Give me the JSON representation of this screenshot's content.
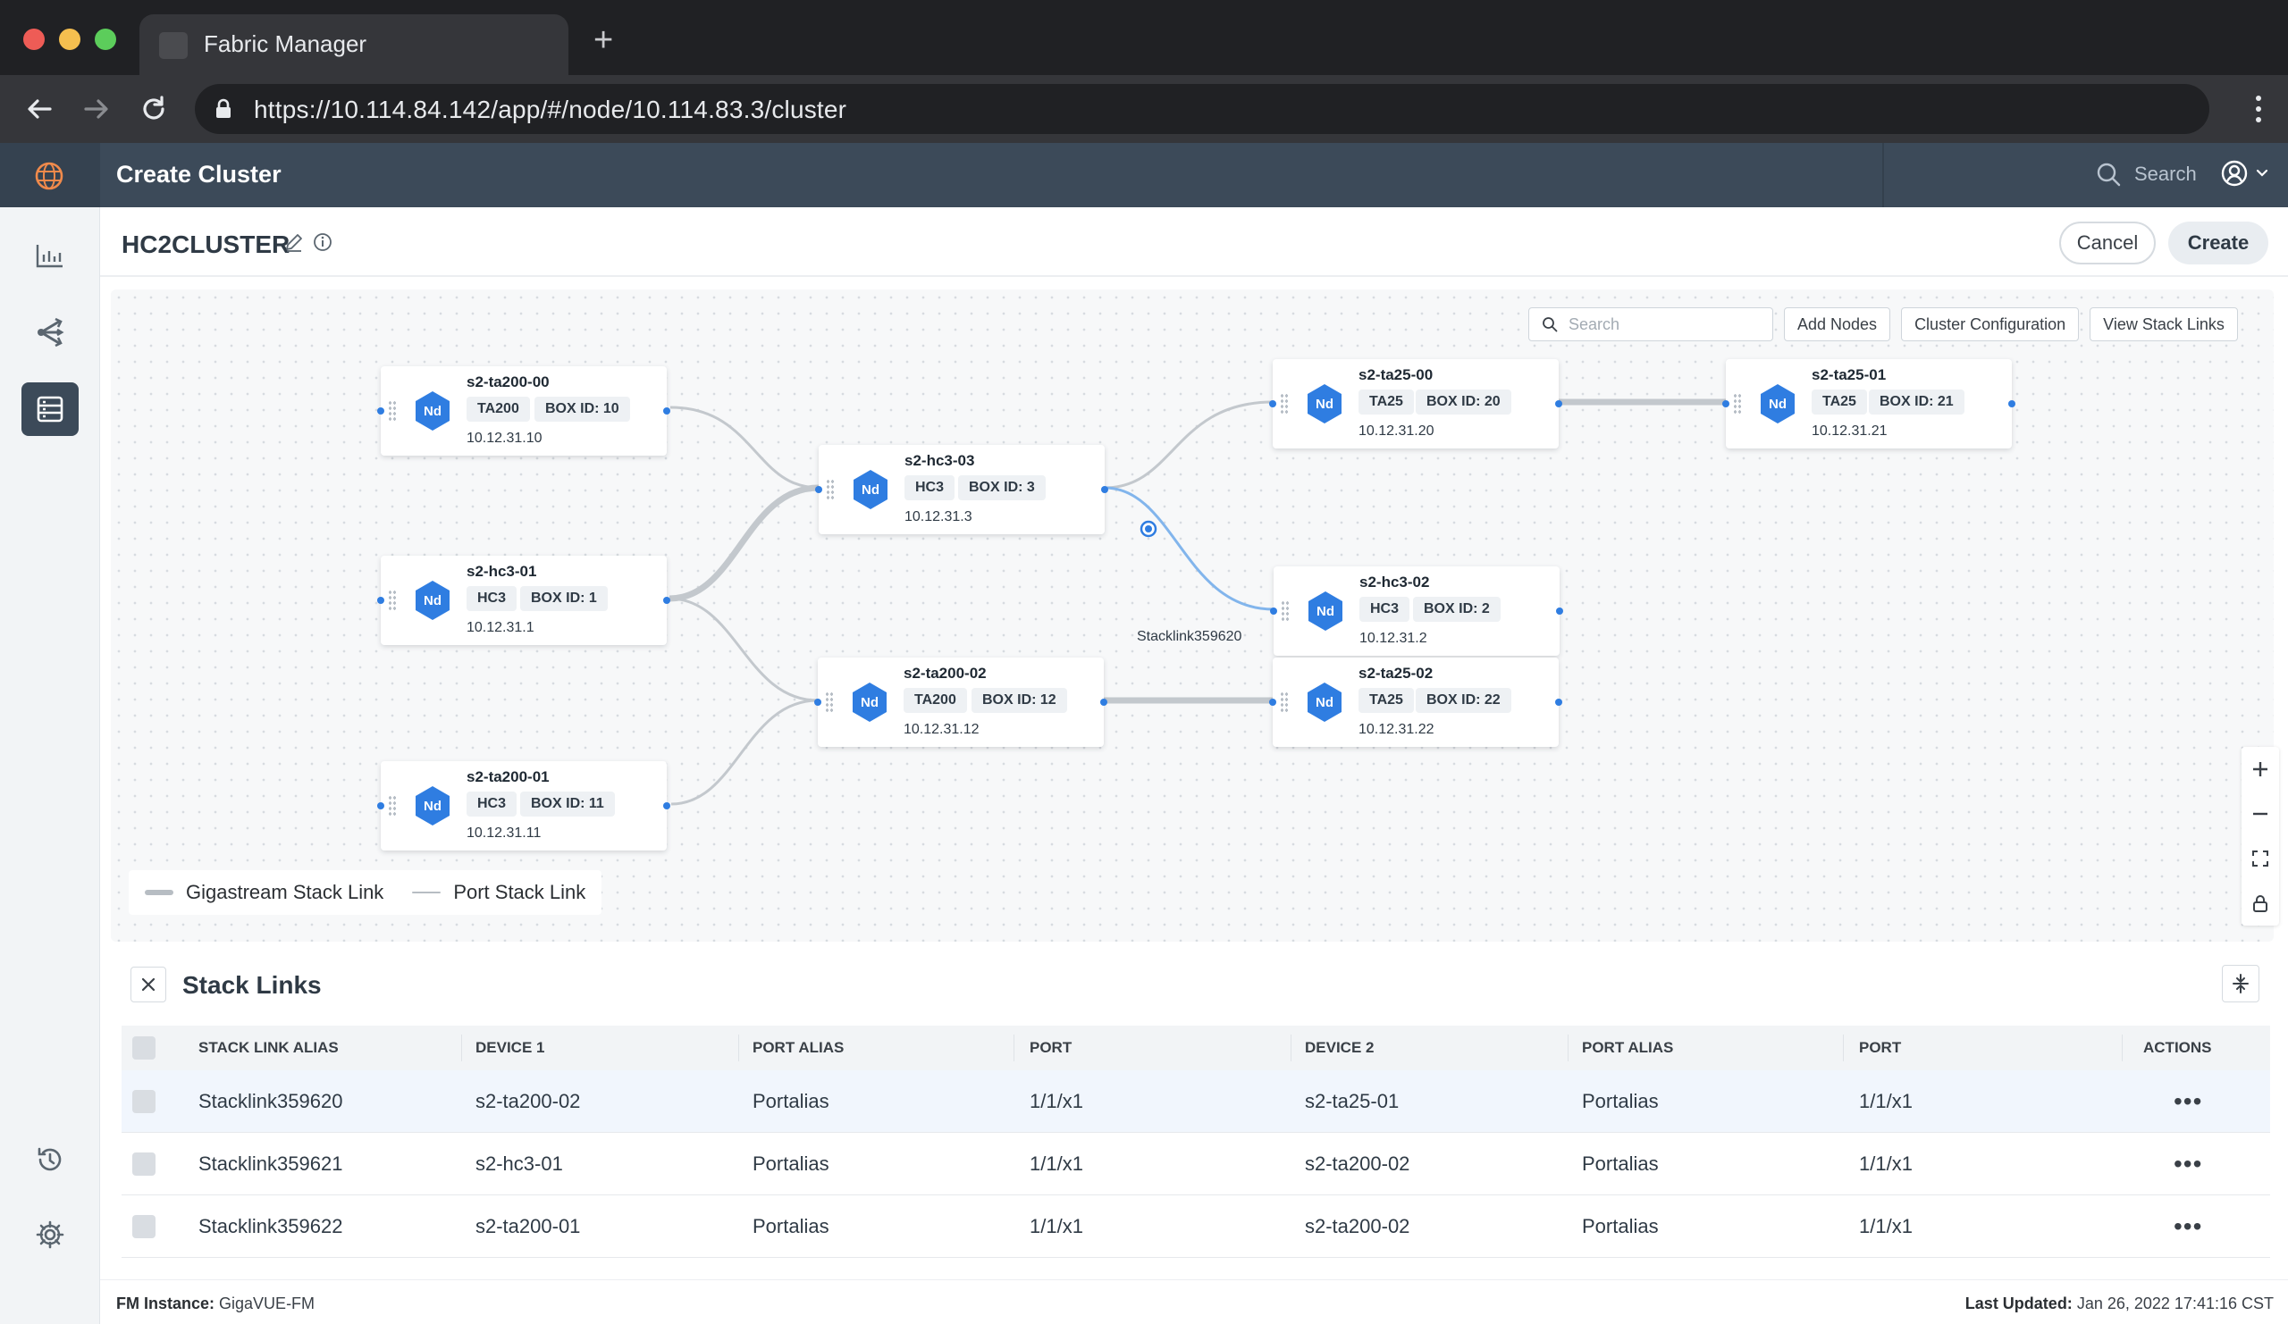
{
  "browser": {
    "tab_title": "Fabric Manager",
    "url": "https://10.114.84.142/app/#/node/10.114.83.3/cluster"
  },
  "header": {
    "title": "Create Cluster",
    "search_label": "Search"
  },
  "cluster": {
    "name": "HC2CLUSTER",
    "cancel_label": "Cancel",
    "create_label": "Create"
  },
  "canvas": {
    "search_placeholder": "Search",
    "add_nodes_label": "Add Nodes",
    "cluster_config_label": "Cluster Configuration",
    "view_stack_links_label": "View Stack Links",
    "link_label": "Stacklink359620",
    "legend": {
      "gigastream": "Gigastream Stack Link",
      "port": "Port Stack Link"
    },
    "badge": "Nd",
    "nodes": [
      {
        "name": "s2-ta200-00",
        "type": "TA200",
        "box": "BOX ID: 10",
        "ip": "10.12.31.10"
      },
      {
        "name": "s2-hc3-01",
        "type": "HC3",
        "box": "BOX ID: 1",
        "ip": "10.12.31.1"
      },
      {
        "name": "s2-ta200-01",
        "type": "HC3",
        "box": "BOX ID: 11",
        "ip": "10.12.31.11"
      },
      {
        "name": "s2-hc3-03",
        "type": "HC3",
        "box": "BOX ID: 3",
        "ip": "10.12.31.3"
      },
      {
        "name": "s2-ta200-02",
        "type": "TA200",
        "box": "BOX ID: 12",
        "ip": "10.12.31.12"
      },
      {
        "name": "s2-ta25-00",
        "type": "TA25",
        "box": "BOX ID: 20",
        "ip": "10.12.31.20"
      },
      {
        "name": "s2-hc3-02",
        "type": "HC3",
        "box": "BOX ID: 2",
        "ip": "10.12.31.2"
      },
      {
        "name": "s2-ta25-02",
        "type": "TA25",
        "box": "BOX ID: 22",
        "ip": "10.12.31.22"
      },
      {
        "name": "s2-ta25-01",
        "type": "TA25",
        "box": "BOX ID: 21",
        "ip": "10.12.31.21"
      }
    ]
  },
  "stack_links": {
    "title": "Stack Links",
    "columns": [
      "STACK LINK ALIAS",
      "DEVICE 1",
      "PORT ALIAS",
      "PORT",
      "DEVICE 2",
      "PORT ALIAS",
      "PORT",
      "ACTIONS"
    ],
    "rows": [
      {
        "alias": "Stacklink359620",
        "device1": "s2-ta200-02",
        "port_alias1": "Portalias",
        "port1": "1/1/x1",
        "device2": "s2-ta25-01",
        "port_alias2": "Portalias",
        "port2": "1/1/x1",
        "actions": "•••"
      },
      {
        "alias": "Stacklink359621",
        "device1": "s2-hc3-01",
        "port_alias1": "Portalias",
        "port1": "1/1/x1",
        "device2": "s2-ta200-02",
        "port_alias2": "Portalias",
        "port2": "1/1/x1",
        "actions": "•••"
      },
      {
        "alias": "Stacklink359622",
        "device1": "s2-ta200-01",
        "port_alias1": "Portalias",
        "port1": "1/1/x1",
        "device2": "s2-ta200-02",
        "port_alias2": "Portalias",
        "port2": "1/1/x1",
        "actions": "•••"
      }
    ]
  },
  "footer": {
    "instance_label": "FM Instance:",
    "instance_value": "GigaVUE-FM",
    "updated_label": "Last Updated:",
    "updated_value": "Jan 26, 2022 17:41:16 CST"
  }
}
